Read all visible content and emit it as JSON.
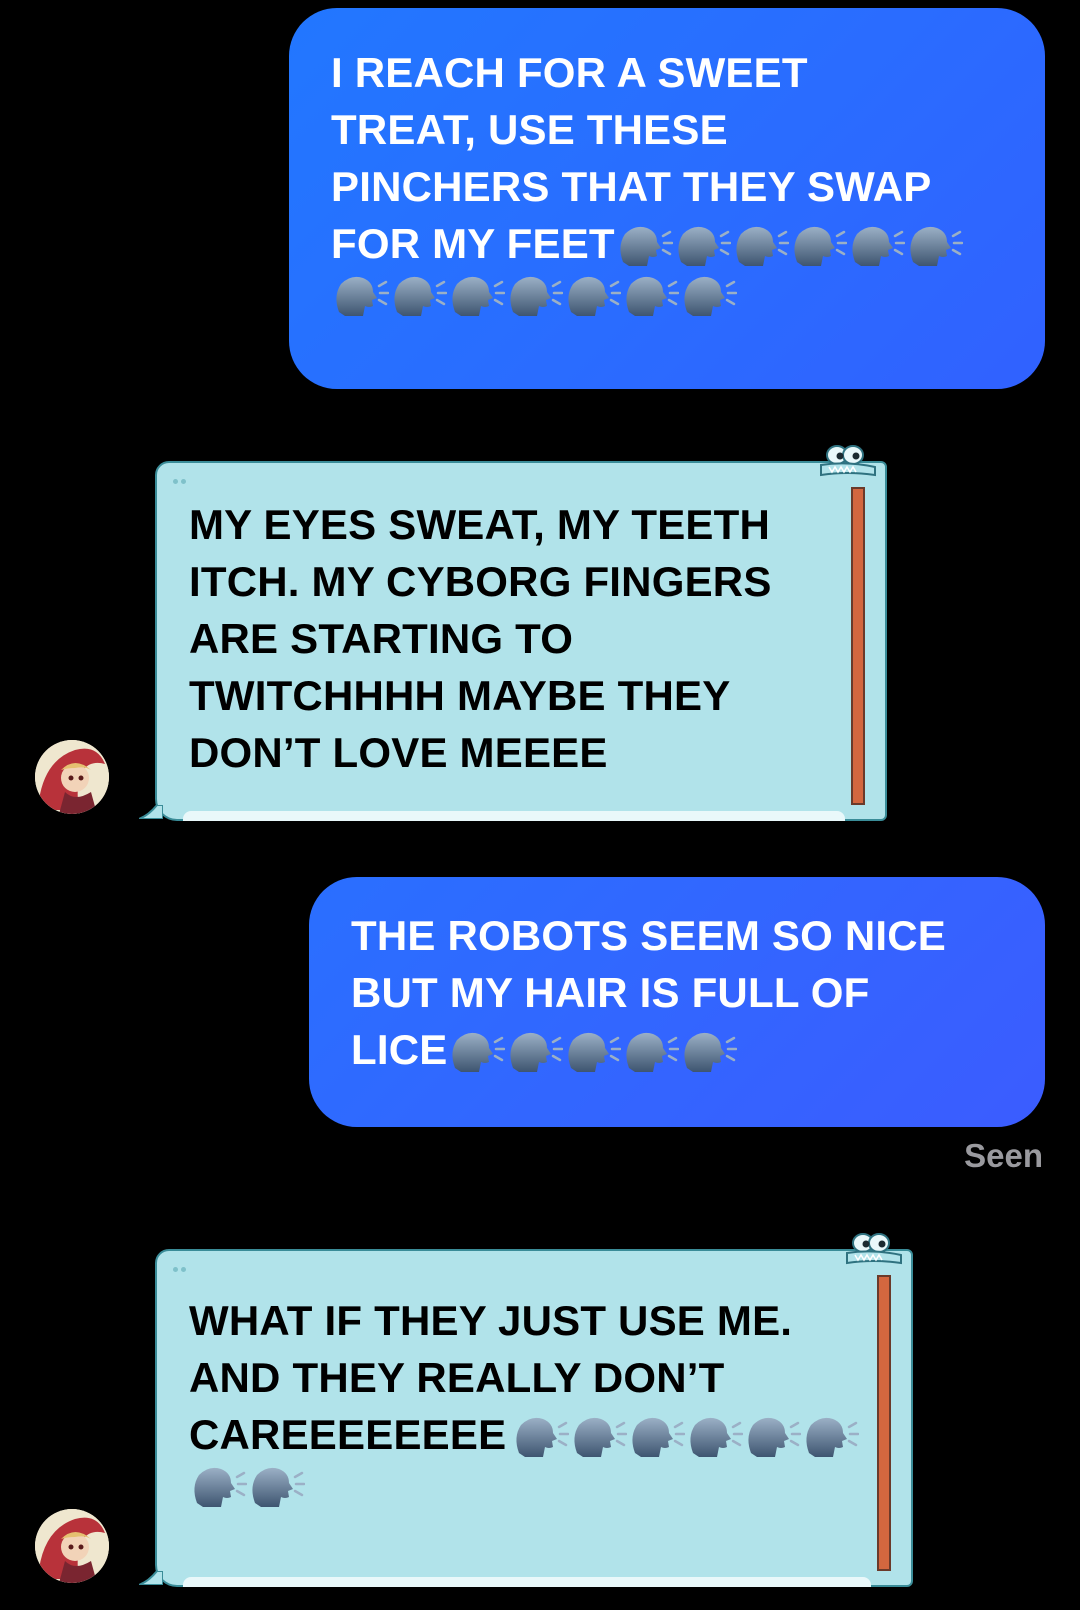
{
  "colors": {
    "background": "#000000",
    "outgoing_bubble": "#2a6cff",
    "incoming_bubble": "#b1e3ea",
    "incoming_accent": "#d3673f",
    "seen_text": "#9a9a9f"
  },
  "messages": [
    {
      "direction": "outgoing",
      "text": "I REACH FOR A SWEET\nTREAT, USE THESE\nPINCHERS THAT THEY SWAP\nFOR MY FEET",
      "emoji_name": "speaking-head-icon",
      "emoji_count": 13
    },
    {
      "direction": "incoming",
      "text": "MY EYES SWEAT, MY TEETH\nITCH. MY CYBORG FINGERS\nARE STARTING TO\nTWITCHHHH MAYBE THEY\nDON’T LOVE MEEEE",
      "avatar": "avatar-icon"
    },
    {
      "direction": "outgoing",
      "text": "THE ROBOTS SEEM SO NICE\nBUT MY HAIR IS FULL OF\nLICE",
      "emoji_name": "speaking-head-icon",
      "emoji_count": 5
    },
    {
      "direction": "incoming",
      "text": "WHAT IF THEY JUST USE ME.\nAND THEY REALLY DON’T\nCAREEEEEEEE",
      "emoji_name": "speaking-head-icon",
      "emoji_count": 8,
      "avatar": "avatar-icon"
    }
  ],
  "status": {
    "seen_label": "Seen"
  }
}
